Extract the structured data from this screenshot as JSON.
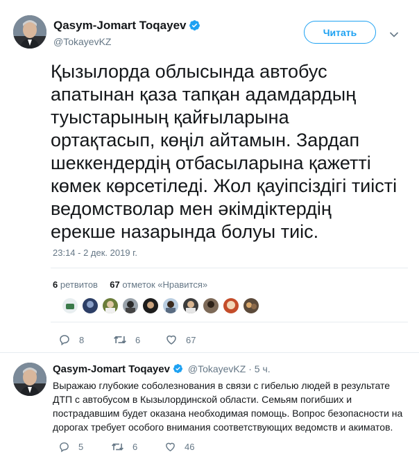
{
  "main_tweet": {
    "author_name": "Qasym-Jomart Toqayev",
    "author_handle": "@TokayevKZ",
    "follow_label": "Читать",
    "text": "Қызылорда облысында автобус апатынан қаза тапқан адамдардың туыстарының қайғыларына ортақтасып, көңіл айтамын. Зардап шеккендердің отбасыларына қажетті көмек көрсетіледі. Жол қауіпсіздігі тиісті ведомстволар мен әкімдіктердің ерекше назарында болуы тиіс.",
    "timestamp": "23:14 - 2 дек. 2019 г.",
    "retweets_count": "6",
    "retweets_label": "ретвитов",
    "likes_count": "67",
    "likes_label": "отметок «Нравится»",
    "actions": {
      "replies": "8",
      "retweets": "6",
      "likes": "67"
    }
  },
  "reply_tweet": {
    "author_name": "Qasym-Jomart Toqayev",
    "author_handle": "@TokayevKZ",
    "time_ago": "5 ч.",
    "separator": "·",
    "text": "Выражаю глубокие соболезнования в связи с гибелью людей в результате ДТП с автобусом в Кызылординской области. Семьям погибших и пострадавшим будет оказана необходимая помощь. Вопрос безопасности на дорогах требует особого внимания соответствующих ведомств и акиматов.",
    "actions": {
      "replies": "5",
      "retweets": "6",
      "likes": "46"
    }
  },
  "colors": {
    "accent": "#1da1f2",
    "secondary_text": "#657786",
    "primary_text": "#14171a"
  },
  "icons": [
    "verified-badge-icon",
    "chevron-down-icon",
    "reply-icon",
    "retweet-icon",
    "like-icon"
  ]
}
